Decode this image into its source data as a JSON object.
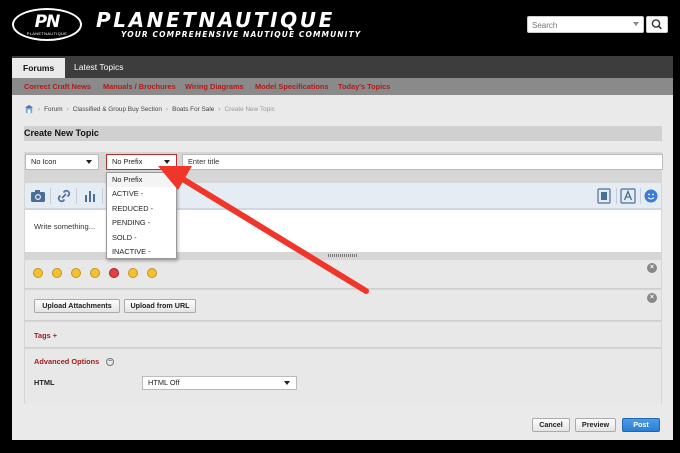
{
  "header": {
    "logo_text": "PN",
    "logo_sub": "PLANETNAUTIQUE",
    "brand": "PLANETNAUTIQUE",
    "tagline": "YOUR COMPREHENSIVE NAUTIQUE COMMUNITY",
    "search_placeholder": "Search"
  },
  "tabs": [
    {
      "label": "Forums"
    },
    {
      "label": "Latest Topics"
    }
  ],
  "subnav": [
    {
      "label": "Correct Craft News"
    },
    {
      "label": "Manuals / Brochures"
    },
    {
      "label": "Wiring Diagrams"
    },
    {
      "label": "Model Specifications"
    },
    {
      "label": "Today's Topics"
    }
  ],
  "breadcrumb": [
    "Forum",
    "Classified & Group Buy Section",
    "Boats For Sale",
    "Create New Topic"
  ],
  "page_title": "Create New Topic",
  "form": {
    "icon_select": "No Icon",
    "prefix_select": "No Prefix",
    "title_placeholder": "Enter title",
    "editor_placeholder": "Write something...",
    "prefix_options": [
      "No Prefix",
      "ACTIVE -",
      "REDUCED -",
      "PENDING -",
      "SOLD -",
      "INACTIVE -"
    ],
    "upload_attachments": "Upload Attachments",
    "upload_from_url": "Upload from URL",
    "tags_label": "Tags +",
    "advanced_label": "Advanced Options",
    "advanced_toggle": "−",
    "html_label": "HTML",
    "html_value": "HTML Off",
    "close_glyph": "×"
  },
  "actions": {
    "cancel": "Cancel",
    "preview": "Preview",
    "post": "Post"
  },
  "colors": {
    "accent_red": "#b01b1b",
    "post_blue": "#2a7fd4",
    "annotation_arrow": "#f0362a"
  }
}
